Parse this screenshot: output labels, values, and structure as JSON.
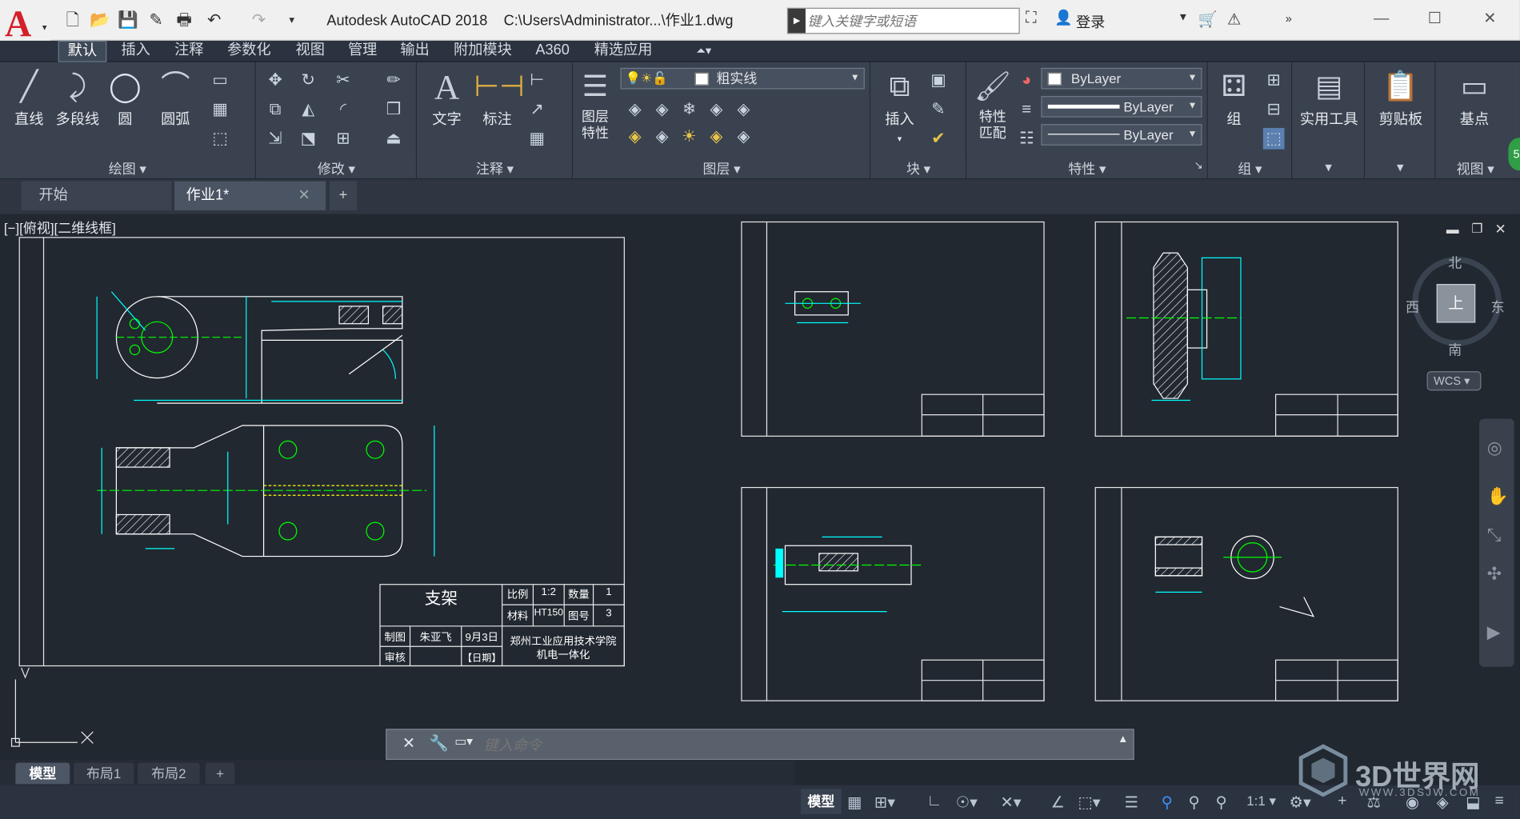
{
  "app": {
    "title": "Autodesk AutoCAD 2018",
    "file_path": "C:\\Users\\Administrator...\\作业1.dwg",
    "search_placeholder": "键入关键字或短语",
    "login_label": "登录"
  },
  "menu_tabs": [
    "默认",
    "插入",
    "注释",
    "参数化",
    "视图",
    "管理",
    "输出",
    "附加模块",
    "A360",
    "精选应用"
  ],
  "ribbon": {
    "draw": {
      "label": "绘图",
      "tools": [
        "直线",
        "多段线",
        "圆",
        "圆弧"
      ]
    },
    "modify": {
      "label": "修改"
    },
    "annotation": {
      "label": "注释",
      "tools": [
        "文字",
        "标注"
      ]
    },
    "layers": {
      "label": "图层",
      "layer_props": "图层\n特性",
      "current_layer": "粗实线"
    },
    "block": {
      "label": "块",
      "insert": "插入"
    },
    "properties": {
      "label": "特性",
      "match": "特性\n匹配",
      "color": "ByLayer",
      "linetype": "ByLayer",
      "lineweight": "ByLayer"
    },
    "groups": {
      "label": "组",
      "tool": "组"
    },
    "utilities": {
      "label": "实用工具"
    },
    "clipboard": {
      "label": "剪贴板"
    },
    "view": {
      "label": "视图",
      "base": "基点"
    }
  },
  "doc_tabs": [
    {
      "label": "开始",
      "active": false
    },
    {
      "label": "作业1*",
      "active": true
    }
  ],
  "viewport_label": "[−][俯视][二维线框]",
  "viewcube": {
    "north": "北",
    "south": "南",
    "east": "东",
    "west": "西",
    "top": "上",
    "wcs": "WCS"
  },
  "title_block": {
    "name": "支架",
    "scale_label": "比例",
    "scale": "1:2",
    "qty_label": "数量",
    "qty": "1",
    "material_label": "材料",
    "material": "HT150",
    "drawing_no_label": "图号",
    "drawing_no": "3",
    "drawn_label": "制图",
    "drawn_by": "朱亚飞",
    "date": "9月3日",
    "check_label": "审核",
    "date_label": "【日期】",
    "school": "郑州工业应用技术学院",
    "dept": "机电一体化"
  },
  "command_line": {
    "placeholder": "键入命令"
  },
  "layout_tabs": [
    "模型",
    "布局1",
    "布局2"
  ],
  "status_bar": {
    "model": "模型",
    "scale": "1:1"
  },
  "watermark": {
    "text": "3D世界网",
    "url": "WWW.3DSJW.COM"
  },
  "colors": {
    "bg": "#212830",
    "ribbon": "#3a4250",
    "cyan": "#00ffff",
    "green": "#00ff00",
    "white": "#ffffff",
    "accent": "#d4202a"
  }
}
